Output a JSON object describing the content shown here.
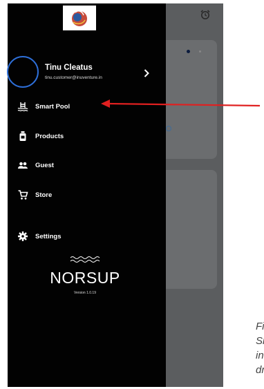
{
  "drawer": {
    "user": {
      "name": "Tinu Cleatus",
      "email": "tinu.customer@inuventure.in"
    },
    "nav": [
      {
        "label": "Smart Pool",
        "icon": "pool-icon"
      },
      {
        "label": "Products",
        "icon": "product-bottle-icon"
      },
      {
        "label": "Guest",
        "icon": "guest-people-icon"
      },
      {
        "label": "Store",
        "icon": "cart-icon"
      },
      {
        "label": "Settings",
        "icon": "gear-icon"
      }
    ],
    "brand": "NORSUP",
    "version": "Version 1.0.19"
  },
  "annotation": {
    "lines": [
      "Fi",
      "Sr",
      "in",
      "dr"
    ]
  },
  "colors": {
    "drawer": "#020202",
    "overlay": "#5b5d5f",
    "accent": "#2e6fd8",
    "arrow": "#e02020"
  }
}
